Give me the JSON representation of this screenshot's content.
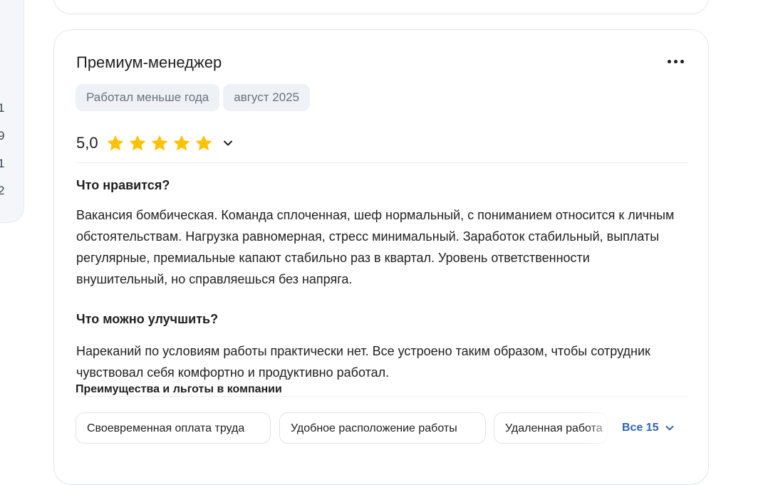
{
  "sidebar": {
    "numbers": [
      "1",
      "9",
      "1",
      "2"
    ]
  },
  "review": {
    "title": "Премиум-менеджер",
    "tags": [
      "Работал меньше года",
      "август 2025"
    ],
    "rating": "5,0",
    "rating_stars": 5,
    "colors": {
      "star": "#FFC100",
      "link": "#2E66B8",
      "tag_bg": "#EEF1F5"
    },
    "likes_title": "Что нравится?",
    "likes_text": "Вакансия бомбическая. Команда сплоченная, шеф нормальный, с пониманием относится к личным обстоятельствам. Нагрузка равномерная, стресс минимальный. Заработок стабильный, выплаты регулярные, премиальные капают стабильно раз в квартал. Уровень ответственности внушительный, но справляешься без напряга.",
    "improve_title": "Что можно улучшить?",
    "improve_text": "Нареканий по условиям работы практически нет. Все устроено таким образом, чтобы сотрудник чувствовал себя комфортно и продуктивно работал.",
    "benefits_title": "Преимущества и льготы в компании",
    "benefits": [
      "Своевременная оплата труда",
      "Удобное расположение работы",
      "Удаленная работа"
    ],
    "all_benefits_label": "Все 15"
  }
}
